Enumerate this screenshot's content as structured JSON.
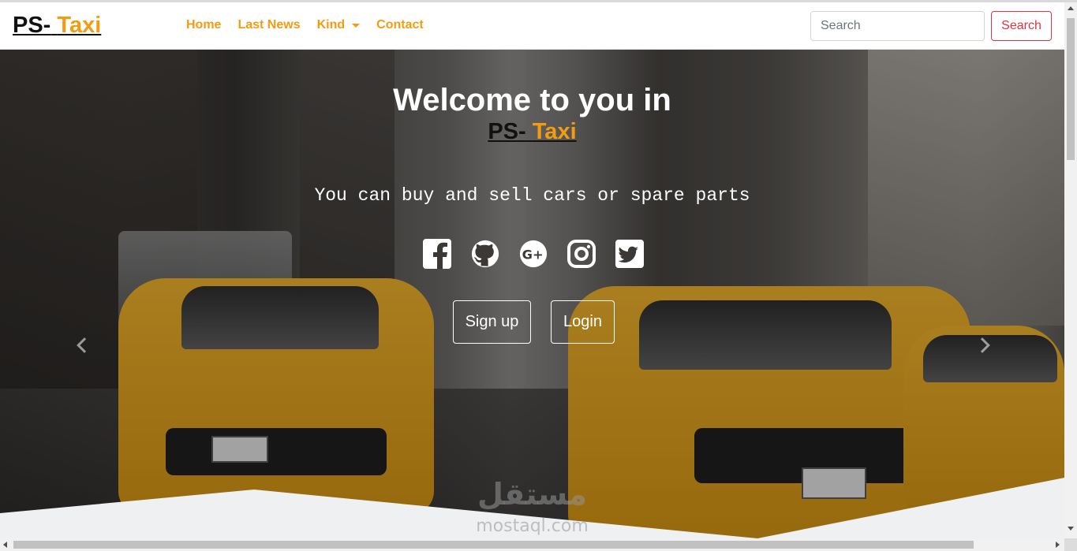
{
  "navbar": {
    "brand_prefix": "PS-",
    "brand_accent": "Taxi",
    "links": [
      {
        "label": "Home"
      },
      {
        "label": "Last News"
      },
      {
        "label": "Kind",
        "dropdown": true
      },
      {
        "label": "Contact"
      }
    ],
    "search": {
      "placeholder": "Search",
      "value": "",
      "button_label": "Search"
    }
  },
  "hero": {
    "title": "Welcome to you in",
    "brand_prefix": "PS-",
    "brand_accent": "Taxi",
    "subtitle": "You can buy and sell cars or spare parts",
    "socials": [
      {
        "icon": "facebook-icon"
      },
      {
        "icon": "github-icon"
      },
      {
        "icon": "google-plus-icon"
      },
      {
        "icon": "instagram-icon"
      },
      {
        "icon": "twitter-icon"
      }
    ],
    "signup_label": "Sign up",
    "login_label": "Login",
    "carousel_prev_icon": "chevron-left-icon",
    "carousel_next_icon": "chevron-right-icon"
  },
  "watermark": {
    "arabic": "مستقل",
    "latin": "mostaql.com"
  },
  "colors": {
    "accent": "#f39c12",
    "danger": "#dc3545",
    "brand_text": "#111111"
  }
}
